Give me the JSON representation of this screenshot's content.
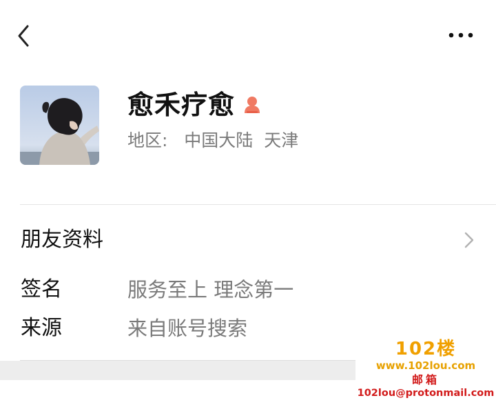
{
  "header": {
    "back_icon": "chevron-left-icon",
    "more_icon": "more-horizontal-icon"
  },
  "profile": {
    "name": "愈禾疗愈",
    "gender_icon": "female-icon",
    "gender_color": "#f07a63",
    "region_label": "地区:",
    "region_value": "中国大陆  天津"
  },
  "friend_info": {
    "label": "朋友资料",
    "chevron_icon": "chevron-right-icon"
  },
  "details": [
    {
      "key": "签名",
      "value": "服务至上 理念第一"
    },
    {
      "key": "来源",
      "value": "来自账号搜索"
    }
  ],
  "watermark": {
    "logo": "102楼",
    "site": "www.102lou.com",
    "mail_title": "邮箱",
    "email": "102lou@protonmail.com"
  }
}
